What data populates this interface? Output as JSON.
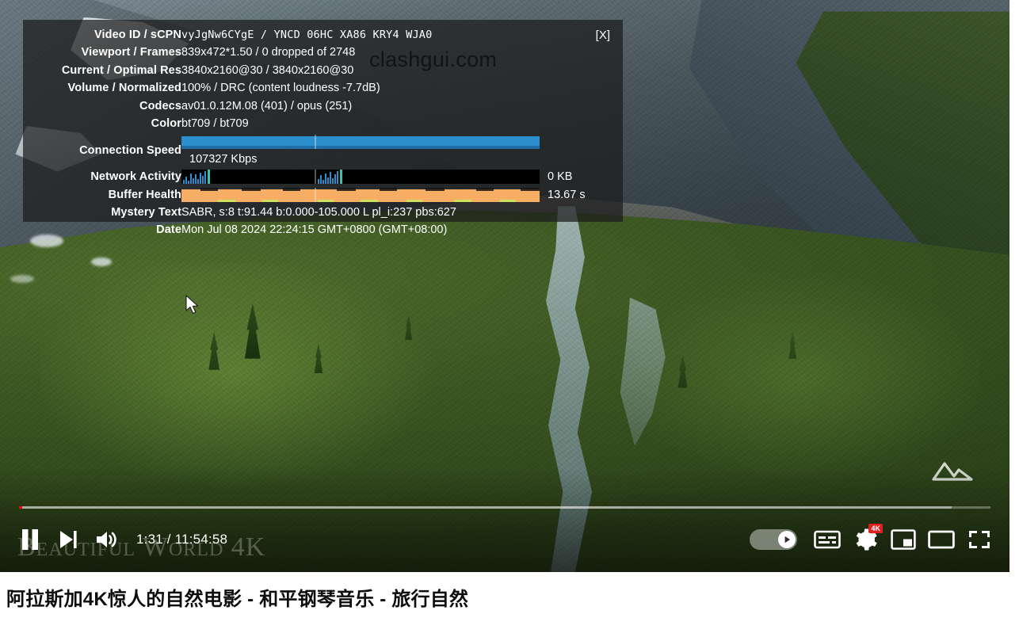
{
  "player": {
    "stats_panel": {
      "close_label": "[X]",
      "watermark": "clashgui.com",
      "rows": [
        {
          "label": "Video ID / sCPN",
          "value": "vyJgNw6CYgE  /  YNCD 06HC XA86 KRY4 WJA0",
          "mono": true
        },
        {
          "label": "Viewport / Frames",
          "value": "839x472*1.50 / 0 dropped of 2748"
        },
        {
          "label": "Current / Optimal Res",
          "value": "3840x2160@30 / 3840x2160@30"
        },
        {
          "label": "Volume / Normalized",
          "value": "100% / DRC (content loudness -7.7dB)"
        },
        {
          "label": "Codecs",
          "value": "av01.0.12M.08 (401) / opus (251)"
        },
        {
          "label": "Color",
          "value": "bt709 / bt709"
        }
      ],
      "graph_rows": [
        {
          "label": "Connection Speed",
          "value": "107327 Kbps"
        },
        {
          "label": "Network Activity",
          "value": "0 KB"
        },
        {
          "label": "Buffer Health",
          "value": "13.67 s"
        }
      ],
      "tail_rows": [
        {
          "label": "Mystery Text",
          "value": "SABR, s:8 t:91.44 b:0.000-105.000 L pl_i:237 pbs:627"
        },
        {
          "label": "Date",
          "value": "Mon Jul 08 2024 22:24:15 GMT+0800 (GMT+08:00)"
        }
      ]
    },
    "overlay_brand": "Beautiful World 4K",
    "controls": {
      "pause_label": "Pause",
      "next_label": "Next",
      "mute_label": "Mute",
      "time": "1:31 / 11:54:58",
      "autoplay_label": "Autoplay is on",
      "subtitles_label": "Subtitles",
      "settings_label": "Settings",
      "settings_badge": "4K",
      "miniplayer_label": "Miniplayer",
      "theater_label": "Theater mode",
      "fullscreen_label": "Full screen"
    },
    "progress": {
      "played_percent": 0.36,
      "loaded_percent": 96
    }
  },
  "page": {
    "video_title": "阿拉斯加4K惊人的自然电影 - 和平钢琴音乐 - 旅行自然"
  },
  "colors": {
    "connection_bar": "#2b8fce",
    "buffer_bar": "#f7ad63",
    "network_bg": "#000000",
    "progress_played": "#ff0000",
    "badge": "#e02020"
  }
}
